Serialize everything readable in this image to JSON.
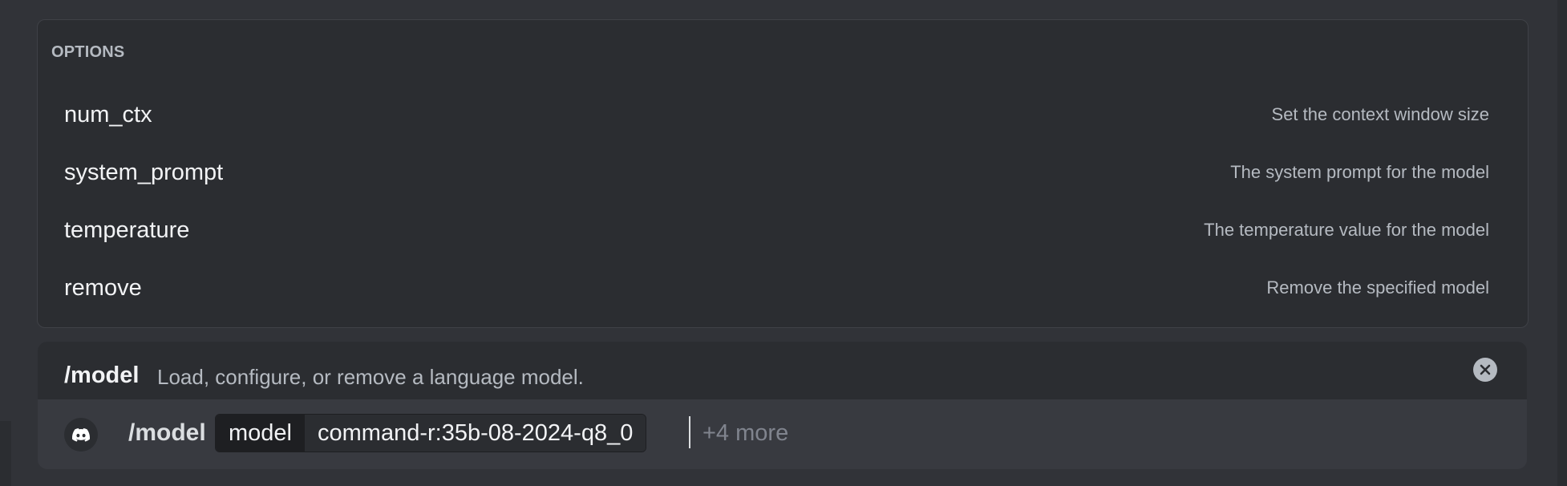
{
  "options": {
    "header": "OPTIONS",
    "items": [
      {
        "name": "num_ctx",
        "description": "Set the context window size"
      },
      {
        "name": "system_prompt",
        "description": "The system prompt for the model"
      },
      {
        "name": "temperature",
        "description": "The temperature value for the model"
      },
      {
        "name": "remove",
        "description": "Remove the specified model"
      }
    ]
  },
  "command": {
    "title": "/model",
    "description": "Load, configure, or remove a language model."
  },
  "input": {
    "app_icon": "discord-logo-icon",
    "command": "/model",
    "param_name": "model",
    "param_value": "command-r:35b-08-2024-q8_0",
    "more_hint": "+4 more"
  },
  "icons": {
    "close": "close-icon"
  },
  "colors": {
    "background": "#313338",
    "panel": "#2b2d31",
    "input_bar": "#383a40",
    "text_primary": "#f2f3f5",
    "text_muted": "#b5bac1",
    "placeholder": "#80848e"
  }
}
